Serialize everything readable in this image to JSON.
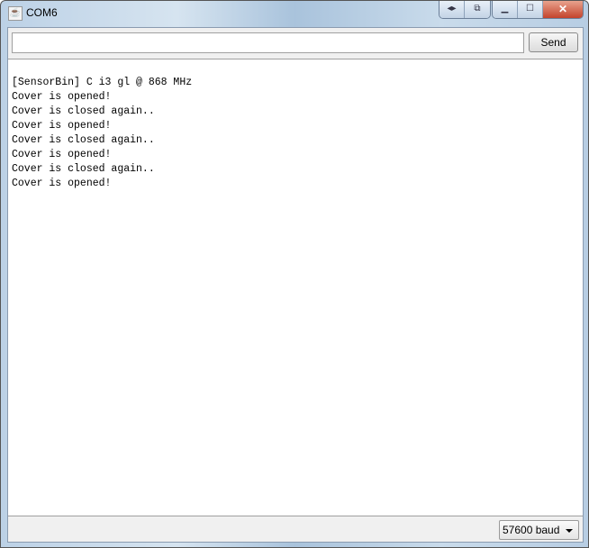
{
  "window": {
    "title": "COM6"
  },
  "input": {
    "value": "",
    "send_label": "Send"
  },
  "output": {
    "lines": [
      "[SensorBin] C i3 gl @ 868 MHz",
      "Cover is opened!",
      "Cover is closed again..",
      "Cover is opened!",
      "Cover is closed again..",
      "Cover is opened!",
      "Cover is closed again..",
      "Cover is opened!"
    ]
  },
  "footer": {
    "baud": "57600 baud"
  }
}
